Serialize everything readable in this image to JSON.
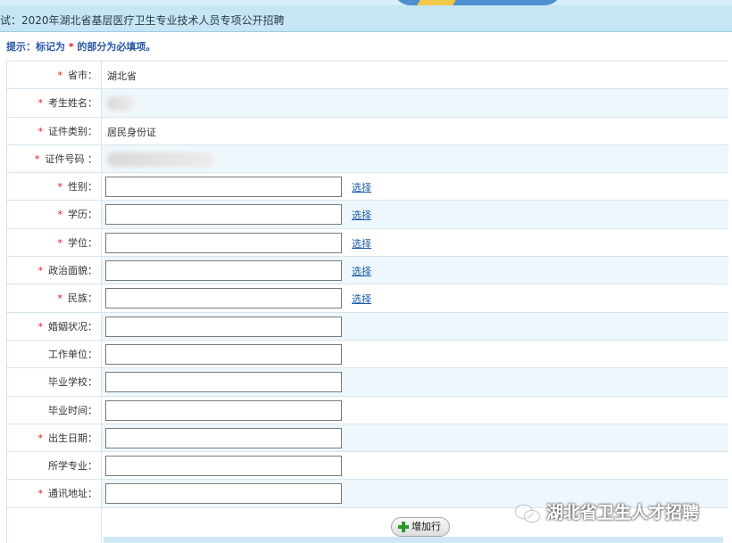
{
  "title": "试：2020年湖北省基层医疗卫生专业技术人员专项公开招聘",
  "hint": {
    "prefix": "提示：标记为",
    "star": " * ",
    "suffix": "的部分为必填项。"
  },
  "choose_label": "选择",
  "fields": [
    {
      "label": "省市：",
      "required": true,
      "type": "static",
      "value": "湖北省"
    },
    {
      "label": "考生姓名：",
      "required": true,
      "type": "blurred",
      "value": ""
    },
    {
      "label": "证件类别：",
      "required": true,
      "type": "static",
      "value": "居民身份证"
    },
    {
      "label": "证件号码 ：",
      "required": true,
      "type": "blurred",
      "value": ""
    },
    {
      "label": "性别：",
      "required": true,
      "type": "input-choose",
      "value": ""
    },
    {
      "label": "学历：",
      "required": true,
      "type": "input-choose",
      "value": ""
    },
    {
      "label": "学位：",
      "required": true,
      "type": "input-choose",
      "value": ""
    },
    {
      "label": "政治面貌：",
      "required": true,
      "type": "input-choose",
      "value": ""
    },
    {
      "label": "民族：",
      "required": true,
      "type": "input-choose",
      "value": ""
    },
    {
      "label": "婚姻状况：",
      "required": true,
      "type": "input",
      "value": ""
    },
    {
      "label": "工作单位：",
      "required": false,
      "type": "input",
      "value": ""
    },
    {
      "label": "毕业学校：",
      "required": false,
      "type": "input",
      "value": ""
    },
    {
      "label": "毕业时间：",
      "required": false,
      "type": "input",
      "value": ""
    },
    {
      "label": "出生日期：",
      "required": true,
      "type": "input",
      "value": ""
    },
    {
      "label": "所学专业：",
      "required": false,
      "type": "input",
      "value": ""
    },
    {
      "label": "通讯地址：",
      "required": true,
      "type": "input",
      "value": ""
    }
  ],
  "add_row_label": "增加行",
  "watermark": "湖北省卫生人才招聘",
  "colors": {
    "title_bar": "#c6e6f4",
    "hint_text": "#2a58a8",
    "required_star": "#e0141e",
    "link": "#1a5aa8",
    "row_alt": "#eef7fc"
  }
}
